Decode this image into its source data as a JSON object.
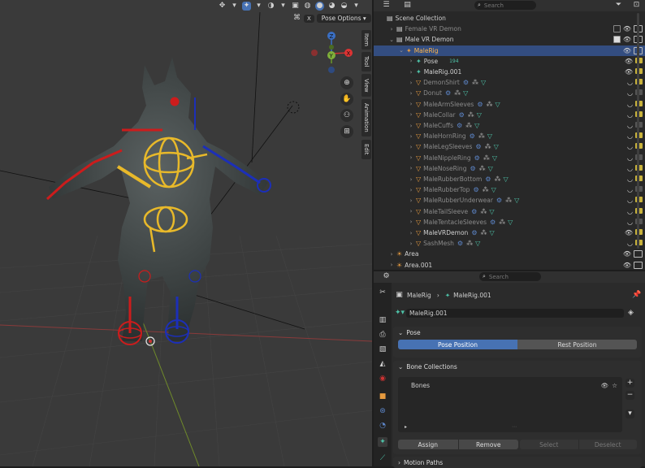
{
  "viewport": {
    "pose_options_label": "Pose Options",
    "close_x": "X",
    "side_tabs": [
      "Item",
      "Tool",
      "View",
      "Animation",
      "Edit"
    ],
    "gizmo": {
      "x": "X",
      "y": "Y",
      "z": "Z"
    }
  },
  "outliner": {
    "search_placeholder": "Search",
    "rows": [
      {
        "label": "Scene Collection",
        "indent": 0,
        "type": "scene",
        "dim": false
      },
      {
        "label": "Female VR Demon",
        "indent": 1,
        "type": "collection",
        "dim": true
      },
      {
        "label": "Male VR Demon",
        "indent": 1,
        "type": "collection",
        "dim": false
      },
      {
        "label": "MaleRig",
        "indent": 2,
        "type": "armature",
        "dim": false,
        "selected": true
      },
      {
        "label": "Pose",
        "indent": 3,
        "type": "pose",
        "dim": false
      },
      {
        "label": "MaleRig.001",
        "indent": 3,
        "type": "armaturedata",
        "dim": false
      },
      {
        "label": "DemonShirt",
        "indent": 3,
        "type": "mesh",
        "dim": true
      },
      {
        "label": "Donut",
        "indent": 3,
        "type": "mesh",
        "dim": true
      },
      {
        "label": "MaleArmSleeves",
        "indent": 3,
        "type": "mesh",
        "dim": true
      },
      {
        "label": "MaleCollar",
        "indent": 3,
        "type": "mesh",
        "dim": true
      },
      {
        "label": "MaleCuffs",
        "indent": 3,
        "type": "mesh",
        "dim": true
      },
      {
        "label": "MaleHornRing",
        "indent": 3,
        "type": "mesh",
        "dim": true
      },
      {
        "label": "MaleLegSleeves",
        "indent": 3,
        "type": "mesh",
        "dim": true
      },
      {
        "label": "MaleNippleRing",
        "indent": 3,
        "type": "mesh",
        "dim": true
      },
      {
        "label": "MaleNoseRing",
        "indent": 3,
        "type": "mesh",
        "dim": true
      },
      {
        "label": "MaleRubberBottom",
        "indent": 3,
        "type": "mesh",
        "dim": true
      },
      {
        "label": "MaleRubberTop",
        "indent": 3,
        "type": "mesh",
        "dim": true
      },
      {
        "label": "MaleRubberUnderwear",
        "indent": 3,
        "type": "mesh",
        "dim": true
      },
      {
        "label": "MaleTailSleeve",
        "indent": 3,
        "type": "mesh",
        "dim": true
      },
      {
        "label": "MaleTentacleSleeves",
        "indent": 3,
        "type": "mesh",
        "dim": true
      },
      {
        "label": "MaleVRDemon",
        "indent": 3,
        "type": "mesh",
        "dim": false
      },
      {
        "label": "SashMesh",
        "indent": 3,
        "type": "mesh",
        "dim": true
      },
      {
        "label": "Area",
        "indent": 1,
        "type": "light",
        "dim": false
      },
      {
        "label": "Area.001",
        "indent": 1,
        "type": "light",
        "dim": false
      }
    ],
    "pose_badge": "194"
  },
  "properties": {
    "search_placeholder": "Search",
    "breadcrumb": [
      "MaleRig",
      "MaleRig.001"
    ],
    "data_name": "MaleRig.001",
    "pose_panel": {
      "title": "Pose",
      "pose_position": "Pose Position",
      "rest_position": "Rest Position"
    },
    "bone_collections": {
      "title": "Bone Collections",
      "items": [
        "Bones"
      ],
      "assign": "Assign",
      "remove": "Remove",
      "select": "Select",
      "deselect": "Deselect"
    },
    "motion_paths": "Motion Paths"
  }
}
